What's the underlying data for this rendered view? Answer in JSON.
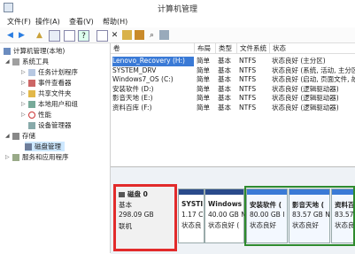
{
  "window": {
    "title": "计算机管理"
  },
  "menu": [
    "文件(F)",
    "操作(A)",
    "查看(V)",
    "帮助(H)"
  ],
  "toolbar_icons": [
    "back-icon",
    "forward-icon",
    "up-icon",
    "show-tree-icon",
    "properties-icon",
    "help-icon",
    "delete-icon",
    "properties2-icon",
    "open-icon",
    "search-icon",
    "zoom-icon"
  ],
  "tree": {
    "root": "计算机管理(本地)",
    "system_tools": "系统工具",
    "task_scheduler": "任务计划程序",
    "event_viewer": "事件查看器",
    "shared_folders": "共享文件夹",
    "local_users": "本地用户和组",
    "performance": "性能",
    "device_manager": "设备管理器",
    "storage": "存储",
    "disk_management": "磁盘管理",
    "services": "服务和应用程序"
  },
  "volumes": {
    "headers": [
      "卷",
      "布局",
      "类型",
      "文件系统",
      "状态"
    ],
    "rows": [
      [
        "Lenovo_Recovery (H:)",
        "简单",
        "基本",
        "NTFS",
        "状态良好 (主分区)"
      ],
      [
        "SYSTEM_DRV",
        "简单",
        "基本",
        "NTFS",
        "状态良好 (系统, 活动, 主分区)"
      ],
      [
        "Windows7_OS (C:)",
        "简单",
        "基本",
        "NTFS",
        "状态良好 (启动, 页面文件, 故障转储, 主分区)"
      ],
      [
        "安装软件 (D:)",
        "简单",
        "基本",
        "NTFS",
        "状态良好 (逻辑驱动器)"
      ],
      [
        "影音天地 (E:)",
        "简单",
        "基本",
        "NTFS",
        "状态良好 (逻辑驱动器)"
      ],
      [
        "资料百库 (F:)",
        "简单",
        "基本",
        "NTFS",
        "状态良好 (逻辑驱动器)"
      ]
    ]
  },
  "disk0": {
    "name": "磁盘 0",
    "type": "基本",
    "size": "298.09 GB",
    "status": "联机"
  },
  "partitions": [
    {
      "name": "SYSTI",
      "size": "1.17 C",
      "status": "状态良"
    },
    {
      "name": "Windows",
      "size": "40.00 GB N",
      "status": "状态良好 ("
    },
    {
      "name": "安装软件 (",
      "size": "80.00 GB I",
      "status": "状态良好"
    },
    {
      "name": "影音天地 (",
      "size": "83.57 GB N",
      "status": "状态良好"
    },
    {
      "name": "资料百",
      "size": "83.57 G",
      "status": "状态良"
    }
  ]
}
